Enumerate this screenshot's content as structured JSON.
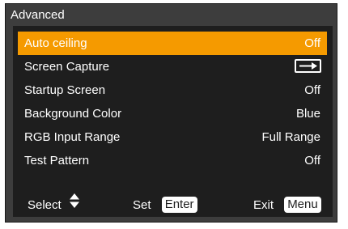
{
  "title": "Advanced",
  "menu_items": [
    {
      "label": "Auto ceiling",
      "value": "Off",
      "selected": true
    },
    {
      "label": "Screen Capture",
      "icon": "enter-arrow-icon",
      "selected": false
    },
    {
      "label": "Startup Screen",
      "value": "Off",
      "selected": false
    },
    {
      "label": "Background Color",
      "value": "Blue",
      "selected": false
    },
    {
      "label": "RGB Input Range",
      "value": "Full Range",
      "selected": false
    },
    {
      "label": "Test Pattern",
      "value": "Off",
      "selected": false
    }
  ],
  "footer": {
    "select_label": "Select",
    "select_icon": "up-down-triangle-icon",
    "set_label": "Set",
    "set_key": "Enter",
    "exit_label": "Exit",
    "exit_key": "Menu"
  },
  "colors": {
    "highlight": "#f59a00",
    "panel": "#1e1e1e",
    "frame": "#3d3d3d"
  }
}
